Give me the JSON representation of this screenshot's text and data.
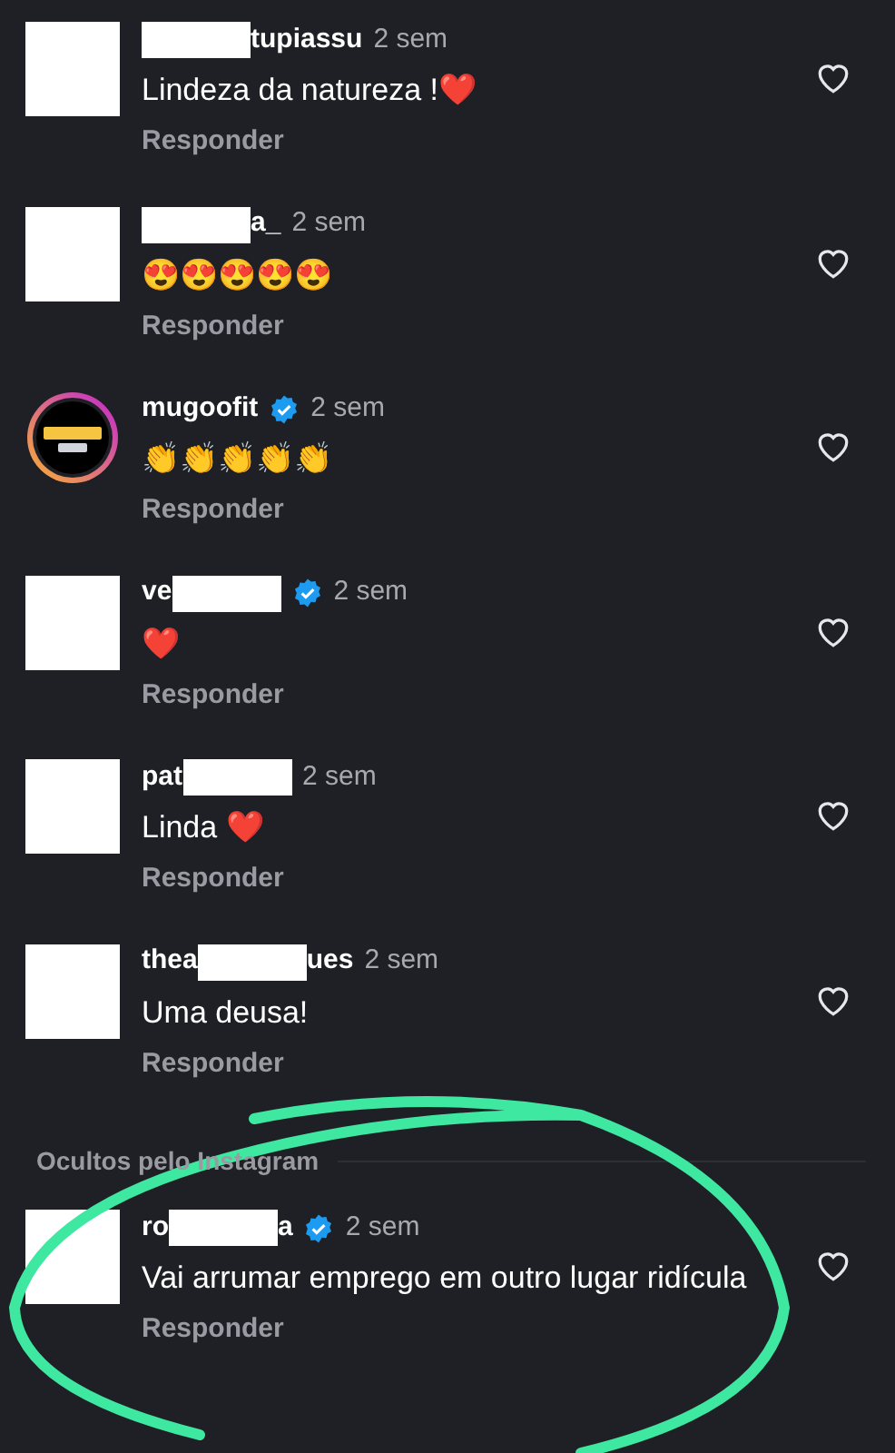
{
  "comments": [
    {
      "avatar": {
        "kind": "redacted"
      },
      "username": [
        {
          "kind": "redacted"
        },
        {
          "kind": "text",
          "text": "tupiassu"
        }
      ],
      "verified": false,
      "time": "2 sem",
      "text": "Lindeza da natureza !❤️",
      "reply": "Responder"
    },
    {
      "avatar": {
        "kind": "redacted"
      },
      "username": [
        {
          "kind": "redacted"
        },
        {
          "kind": "text",
          "text": "a_"
        }
      ],
      "verified": false,
      "time": "2 sem",
      "text": "😍😍😍😍😍",
      "reply": "Responder"
    },
    {
      "avatar": {
        "kind": "picture"
      },
      "username": [
        {
          "kind": "text",
          "text": "mugoofit"
        }
      ],
      "verified": true,
      "time": "2 sem",
      "text": "👏👏👏👏👏",
      "reply": "Responder"
    },
    {
      "avatar": {
        "kind": "redacted"
      },
      "username": [
        {
          "kind": "text",
          "text": "ve"
        },
        {
          "kind": "redacted"
        }
      ],
      "verified": true,
      "time": "2 sem",
      "text": "❤️",
      "reply": "Responder"
    },
    {
      "avatar": {
        "kind": "redacted"
      },
      "username": [
        {
          "kind": "text",
          "text": "pat"
        },
        {
          "kind": "redacted"
        }
      ],
      "verified": false,
      "time": "2 sem",
      "text": "Linda ❤️",
      "reply": "Responder"
    },
    {
      "avatar": {
        "kind": "redacted"
      },
      "username": [
        {
          "kind": "text",
          "text": "thea"
        },
        {
          "kind": "redacted"
        },
        {
          "kind": "text",
          "text": "ues"
        }
      ],
      "verified": false,
      "time": "2 sem",
      "text": "Uma deusa!",
      "reply": "Responder"
    }
  ],
  "hidden_section": {
    "title": "Ocultos pelo Instagram",
    "comments": [
      {
        "avatar": {
          "kind": "redacted"
        },
        "username": [
          {
            "kind": "text",
            "text": "ro"
          },
          {
            "kind": "redacted"
          },
          {
            "kind": "text",
            "text": "a"
          }
        ],
        "verified": true,
        "time": "2 sem",
        "text": "Vai arrumar emprego em outro lugar ridícula",
        "reply": "Responder"
      }
    ]
  }
}
